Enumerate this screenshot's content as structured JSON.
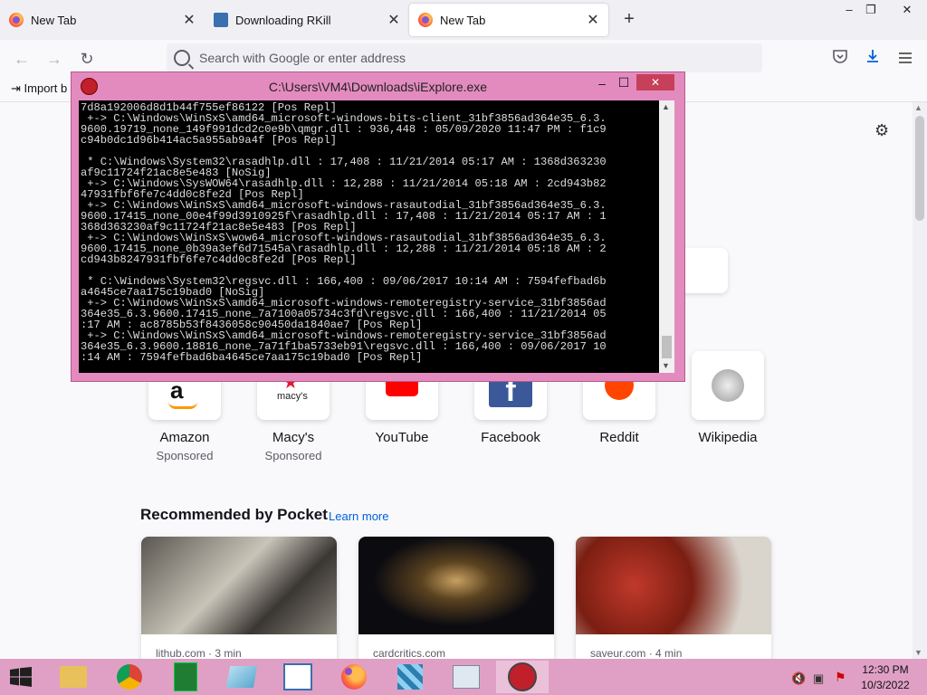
{
  "browser": {
    "tabs": [
      {
        "title": "New Tab",
        "active": false
      },
      {
        "title": "Downloading RKill",
        "active": false
      },
      {
        "title": "New Tab",
        "active": true
      }
    ],
    "new_tab_glyph": "+",
    "window_controls": {
      "minimize": "–",
      "maximize": "❐",
      "close": "✕"
    },
    "url_placeholder": "Search with Google or enter address",
    "bookmark_import": "Import b"
  },
  "shortcuts": [
    {
      "label": "Amazon",
      "sub": "Sponsored",
      "icon": "amazon-icon"
    },
    {
      "label": "Macy's",
      "sub": "Sponsored",
      "icon": "macys-icon"
    },
    {
      "label": "YouTube",
      "sub": "",
      "icon": "youtube-icon"
    },
    {
      "label": "Facebook",
      "sub": "",
      "icon": "facebook-icon"
    },
    {
      "label": "Reddit",
      "sub": "",
      "icon": "reddit-icon"
    },
    {
      "label": "Wikipedia",
      "sub": "",
      "icon": "wikipedia-icon"
    }
  ],
  "pocket": {
    "heading": "Recommended by Pocket",
    "learn_more": "Learn more",
    "cards": [
      {
        "source": "lithub.com · 3 min"
      },
      {
        "source": "cardcritics.com"
      },
      {
        "source": "saveur.com · 4 min"
      }
    ]
  },
  "console": {
    "title": "C:\\Users\\VM4\\Downloads\\iExplore.exe",
    "text": "7d8a192006d8d1b44f755ef86122 [Pos Repl]\n +-> C:\\Windows\\WinSxS\\amd64_microsoft-windows-bits-client_31bf3856ad364e35_6.3.\n9600.19719_none_149f991dcd2c0e9b\\qmgr.dll : 936,448 : 05/09/2020 11:47 PM : f1c9\nc94b0dc1d96b414ac5a955ab9a4f [Pos Repl]\n\n * C:\\Windows\\System32\\rasadhlp.dll : 17,408 : 11/21/2014 05:17 AM : 1368d363230\naf9c11724f21ac8e5e483 [NoSig]\n +-> C:\\Windows\\SysWOW64\\rasadhlp.dll : 12,288 : 11/21/2014 05:18 AM : 2cd943b82\n47931fbf6fe7c4dd0c8fe2d [Pos Repl]\n +-> C:\\Windows\\WinSxS\\amd64_microsoft-windows-rasautodial_31bf3856ad364e35_6.3.\n9600.17415_none_00e4f99d3910925f\\rasadhlp.dll : 17,408 : 11/21/2014 05:17 AM : 1\n368d363230af9c11724f21ac8e5e483 [Pos Repl]\n +-> C:\\Windows\\WinSxS\\wow64_microsoft-windows-rasautodial_31bf3856ad364e35_6.3.\n9600.17415_none_0b39a3ef6d71545a\\rasadhlp.dll : 12,288 : 11/21/2014 05:18 AM : 2\ncd943b8247931fbf6fe7c4dd0c8fe2d [Pos Repl]\n\n * C:\\Windows\\System32\\regsvc.dll : 166,400 : 09/06/2017 10:14 AM : 7594fefbad6b\na4645ce7aa175c19bad0 [NoSig]\n +-> C:\\Windows\\WinSxS\\amd64_microsoft-windows-remoteregistry-service_31bf3856ad\n364e35_6.3.9600.17415_none_7a7100a05734c3fd\\regsvc.dll : 166,400 : 11/21/2014 05\n:17 AM : ac8785b53f8436058c90450da1840ae7 [Pos Repl]\n +-> C:\\Windows\\WinSxS\\amd64_microsoft-windows-remoteregistry-service_31bf3856ad\n364e35_6.3.9600.18816_none_7a71f1ba5733eb91\\regsvc.dll : 166,400 : 09/06/2017 10\n:14 AM : 7594fefbad6ba4645ce7aa175c19bad0 [Pos Repl]",
    "controls": {
      "minimize": "–",
      "maximize": "☐",
      "close": "✕"
    }
  },
  "taskbar": {
    "items": [
      "file-explorer-icon",
      "chrome-icon",
      "calculator-icon",
      "notepad-icon",
      "wordpad-icon",
      "firefox-icon",
      "puzzle-app-icon",
      "system-monitor-icon",
      "rkill-icon"
    ],
    "time": "12:30 PM",
    "date": "10/3/2022"
  },
  "colors": {
    "accent": "#0061e0",
    "console_frame": "#e38bbf",
    "taskbar": "#e0a0c5",
    "console_close": "#c7405a"
  }
}
